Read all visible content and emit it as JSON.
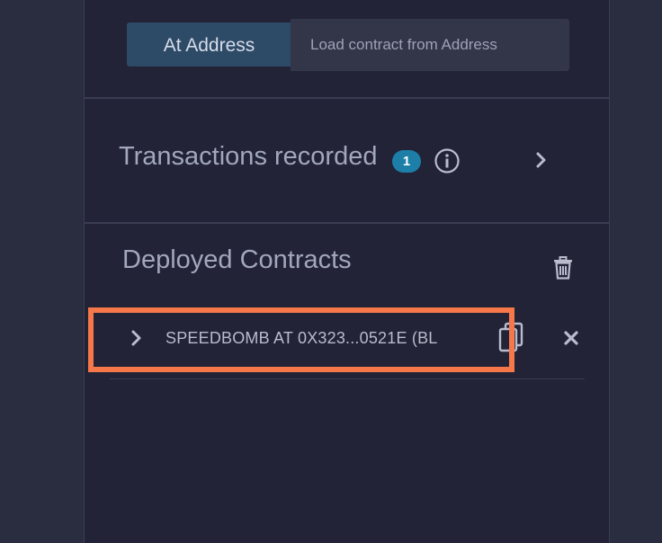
{
  "run_panel": {
    "at_address_button": "At Address",
    "address_input": {
      "value": "",
      "placeholder": "Load contract from Address"
    }
  },
  "transactions": {
    "title": "Transactions recorded",
    "count": "1",
    "info_icon": "info-circle-icon",
    "expand_icon": "chevron-right-icon"
  },
  "deployed": {
    "title": "Deployed Contracts",
    "clear_icon": "trash-icon",
    "contracts": [
      {
        "label": "SPEEDBOMB AT 0X323...0521E (BL",
        "expand_icon": "chevron-right-icon",
        "copy_icon": "copy-icon",
        "remove_icon": "close-icon"
      }
    ]
  },
  "colors": {
    "panel_bg": "#222336",
    "outer_bg": "#2a2c3f",
    "button_bg": "#2d4a66",
    "badge_bg": "#1d7fa8",
    "highlight": "#f5774a",
    "text_muted": "#a2a7bb"
  }
}
